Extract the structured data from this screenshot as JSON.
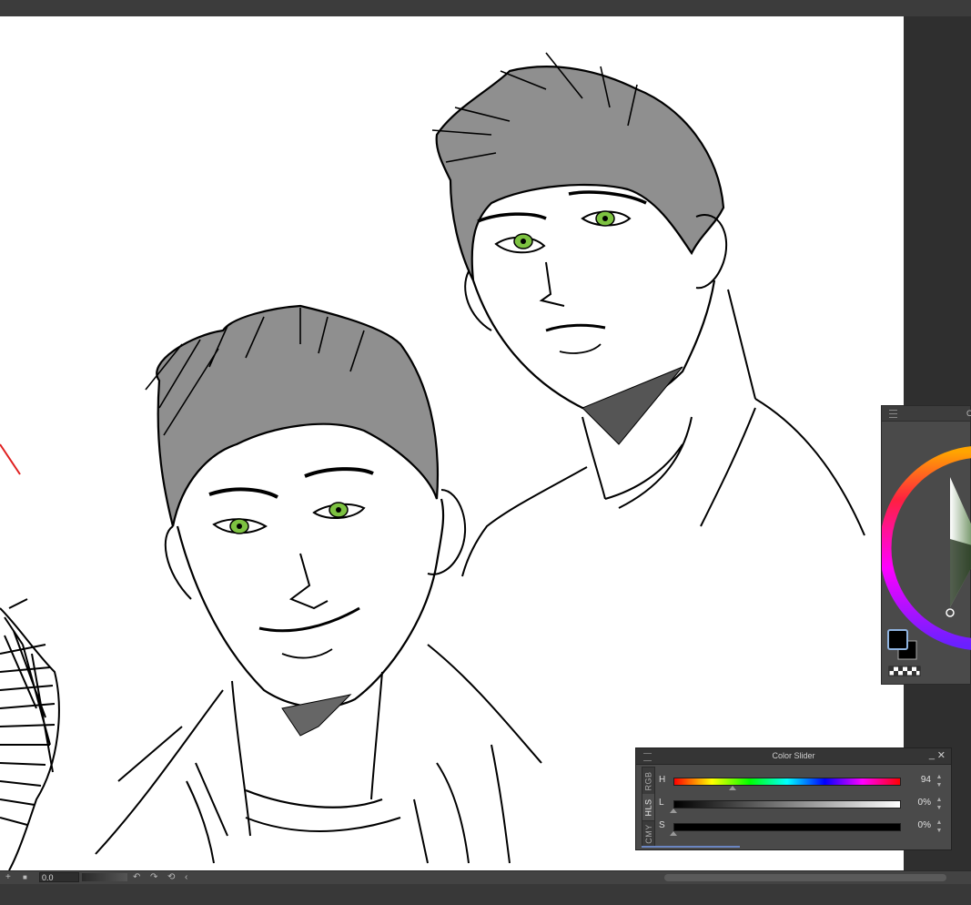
{
  "colors": {
    "canvas_bg": "#ffffff",
    "hair_fill": "#8f8f8f",
    "line_art": "#000000",
    "eye_green": "#7dc241",
    "stray_stroke": "#e02020",
    "panel_bg": "#4a4a4a"
  },
  "color_slider_panel": {
    "title": "Color Slider",
    "minimize_icon": "minimize-icon",
    "close_icon": "close-icon",
    "tabs": [
      "RGB",
      "HLS",
      "CMY"
    ],
    "active_tab": "HLS",
    "sliders": [
      {
        "label": "H",
        "value": "94",
        "fraction": 0.26
      },
      {
        "label": "L",
        "value": "0%",
        "fraction": 0.0
      },
      {
        "label": "S",
        "value": "0%",
        "fraction": 0.0
      }
    ]
  },
  "color_wheel_panel": {
    "title_fragment": "C",
    "main_color": "#000000",
    "sub_color": "#000000",
    "transparent_swatch": "checker-icon"
  },
  "status_bar": {
    "zoom_value": "0.0",
    "icons": [
      "add-icon",
      "square-icon",
      "undo-icon",
      "redo-icon",
      "rotate-reset-icon",
      "collapse-left-icon"
    ]
  }
}
